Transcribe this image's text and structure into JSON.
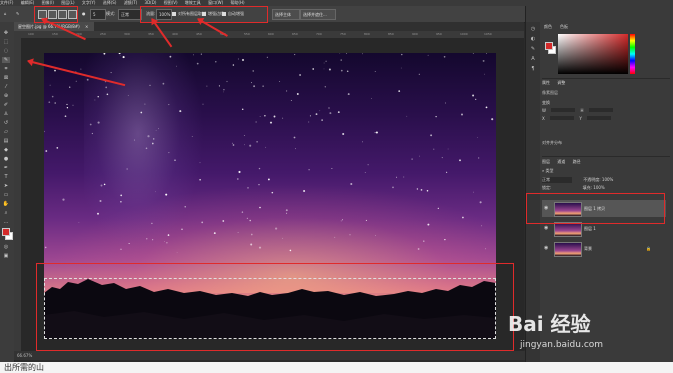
{
  "menu": {
    "items": [
      "文件(F)",
      "编辑(E)",
      "图像(I)",
      "图层(L)",
      "文字(Y)",
      "选择(S)",
      "滤镜(T)",
      "3D(D)",
      "视图(V)",
      "增效工具",
      "窗口(W)",
      "帮助(H)"
    ]
  },
  "options": {
    "size_value": "5",
    "mode_label": "模式:",
    "mode_value": "正常",
    "opacity_label": "不透明度:",
    "opacity_value": "100%",
    "flow_label": "流量:",
    "flow_value": "100%",
    "sample_all_label": "对所有图层取样",
    "enhance_label": "增强边缘",
    "autoenhance_label": "自动增强",
    "select_subject": "选择主体",
    "select_mask": "选择并遮住..."
  },
  "document": {
    "tab_title": "星空图片.jpg @ 66.7%(RGB/8#)",
    "zoom": "66.67%"
  },
  "ruler_ticks": [
    "100",
    "150",
    "200",
    "250",
    "300",
    "350",
    "400",
    "450",
    "500",
    "550",
    "600",
    "650",
    "700",
    "750",
    "800",
    "850",
    "900",
    "950",
    "1000",
    "1050"
  ],
  "panels": {
    "color_tab": "颜色",
    "swatch_tab": "色板",
    "properties_tab": "属性",
    "adjust_tab": "调整",
    "layer_type": "像素图层",
    "transform": "变换",
    "w_label": "W",
    "h_label": "H",
    "x_label": "X",
    "y_label": "Y",
    "align": "对齐并分布",
    "layers_tab": "图层",
    "channels_tab": "通道",
    "paths_tab": "路径",
    "kind": "类型",
    "blend_mode": "正常",
    "opacity_label": "不透明度:",
    "opacity_value": "100%",
    "lock_label": "锁定:",
    "fill_label": "填充:",
    "fill_value": "100%"
  },
  "layers": [
    {
      "name": "图层 1 拷贝",
      "selected": true
    },
    {
      "name": "图层 1",
      "selected": false
    },
    {
      "name": "背景",
      "selected": false
    }
  ],
  "colors": {
    "accent_red": "#e02b2b",
    "foreground": "#d42a2a",
    "background": "#ffffff"
  },
  "watermark": {
    "brand": "Bai 经验",
    "url": "jingyan.baidu.com"
  },
  "caption_bottom": "出所需的山"
}
